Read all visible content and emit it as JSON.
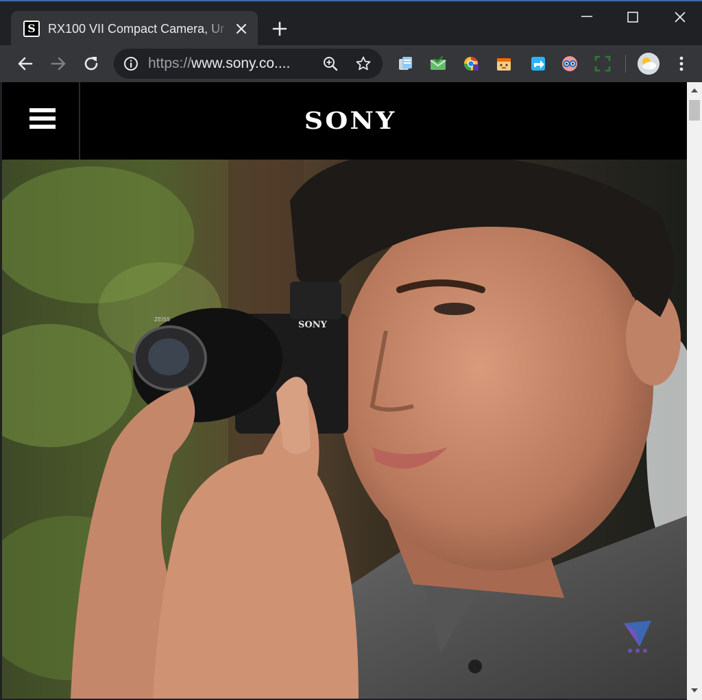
{
  "browser": {
    "tab": {
      "favicon_letter": "S",
      "title": "RX100 VII Compact Camera, Ur"
    },
    "address_bar": {
      "scheme": "https://",
      "host": "www.sony.co...."
    }
  },
  "site": {
    "logo": "SONY",
    "camera_brand": "SONY",
    "lens_brand": "ZEISS"
  },
  "icons": {
    "tab_close": "close-icon",
    "new_tab": "plus-icon",
    "back": "arrow-left-icon",
    "forward": "arrow-right-icon",
    "reload": "reload-icon",
    "site_info": "info-icon",
    "zoom": "zoom-icon",
    "bookmark": "star-icon",
    "menu": "kebab-menu-icon",
    "site_menu": "hamburger-icon"
  },
  "colors": {
    "chrome_dark": "#202124",
    "toolbar": "#35363a",
    "sony_black": "#000000"
  }
}
